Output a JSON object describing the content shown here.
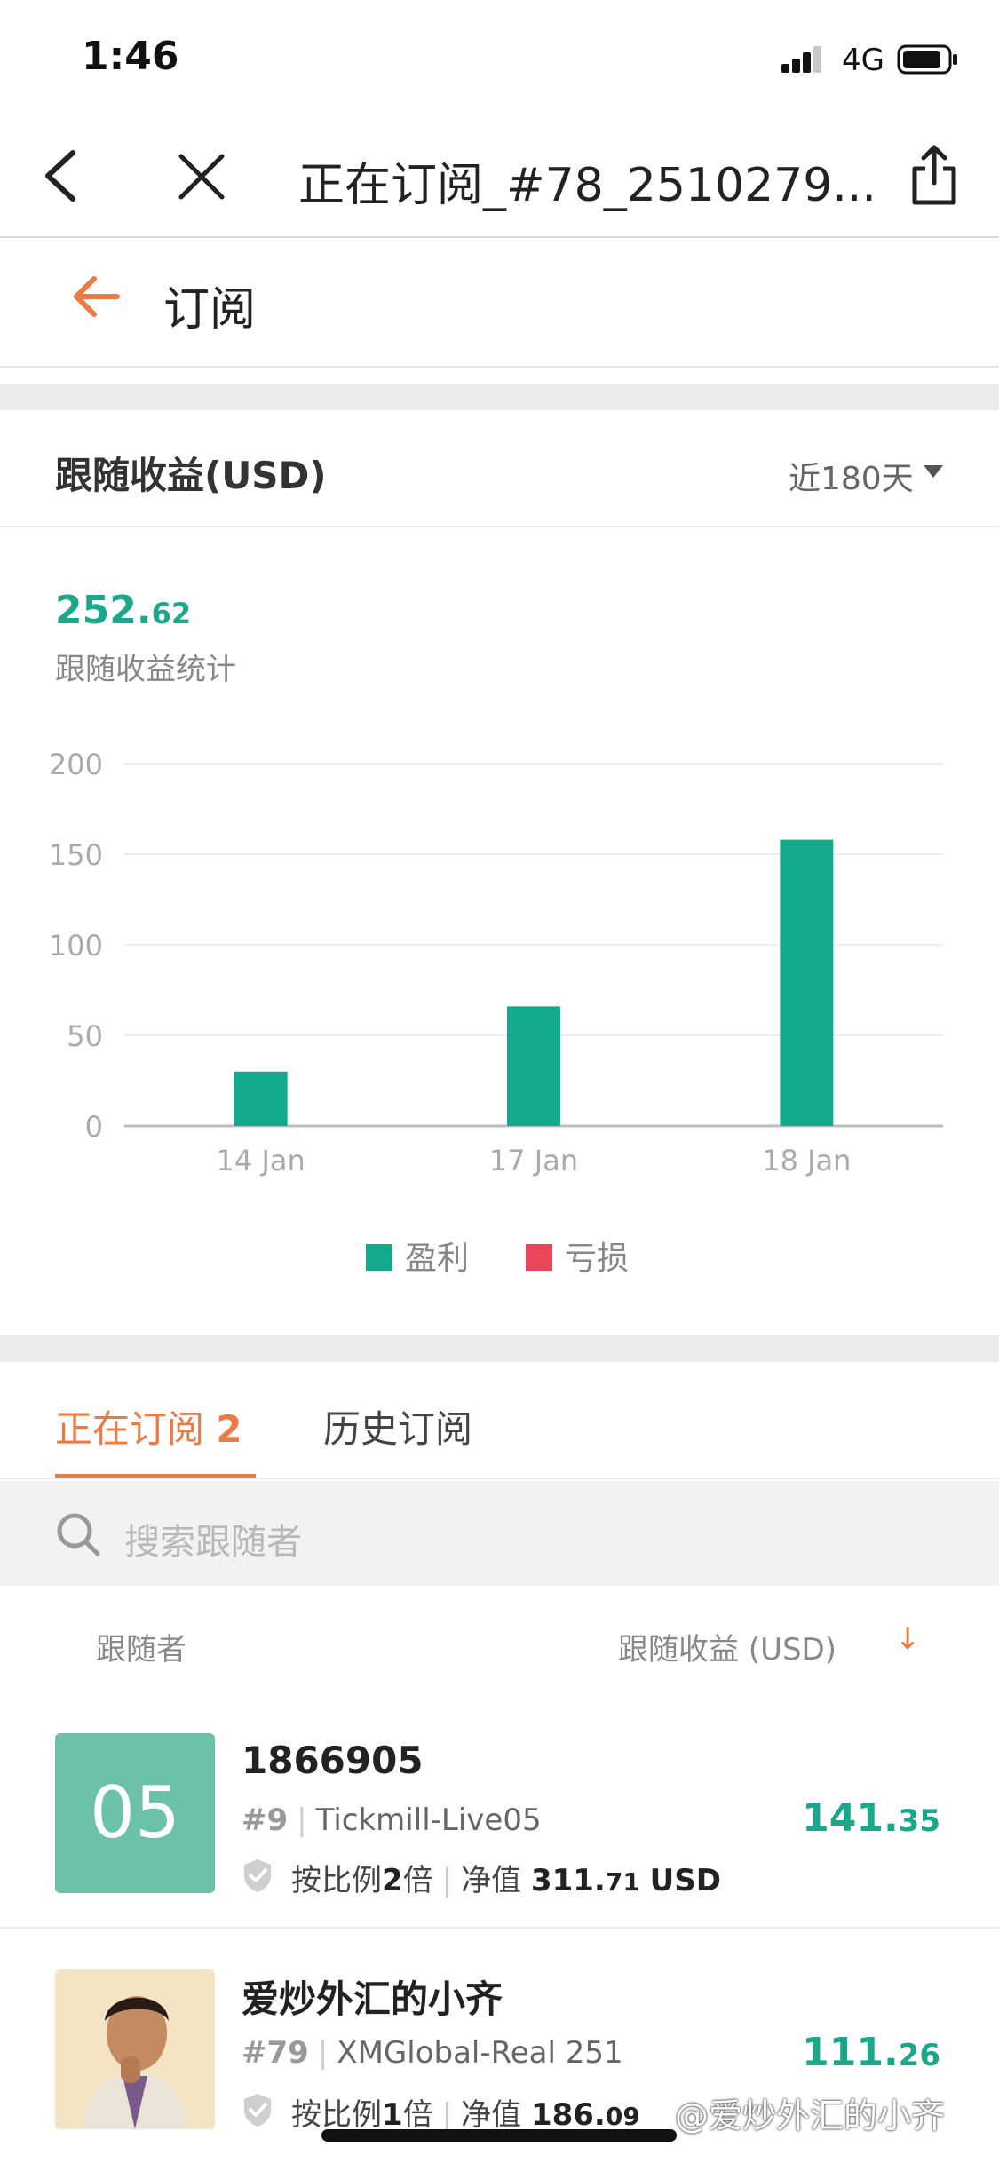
{
  "status_bar": {
    "time": "1:46",
    "network": "4G"
  },
  "browser_nav": {
    "title": "正在订阅_#78_2510279..."
  },
  "page_header": {
    "title": "订阅"
  },
  "profit_card": {
    "title": "跟随收益(USD)",
    "period": "近180天",
    "total_int": "252.",
    "total_dec": "62",
    "total_label": "跟随收益统计"
  },
  "chart_data": {
    "type": "bar",
    "categories": [
      "14 Jan",
      "17 Jan",
      "18 Jan"
    ],
    "series": [
      {
        "name": "盈利",
        "values": [
          30,
          66,
          158
        ],
        "color": "#13aa8b"
      },
      {
        "name": "亏损",
        "values": [
          0,
          0,
          0
        ],
        "color": "#e8475a"
      }
    ],
    "yticks": [
      0,
      50,
      100,
      150,
      200
    ],
    "ylim": [
      0,
      200
    ],
    "grid": true,
    "legend_position": "bottom-center"
  },
  "tabs": {
    "active_label": "正在订阅",
    "active_count": "2",
    "history_label": "历史订阅"
  },
  "search": {
    "placeholder": "搜索跟随者"
  },
  "list_header": {
    "follower": "跟随者",
    "profit": "跟随收益 (USD)"
  },
  "rows": [
    {
      "avatar_text": "05",
      "name": "1866905",
      "rank": "#9",
      "server": "Tickmill-Live05",
      "ratio_prefix": "按比例",
      "ratio_value": "2",
      "ratio_suffix": "倍",
      "equity_label": "净值",
      "equity_int": "311.",
      "equity_dec": "71",
      "equity_unit": "USD",
      "profit_int": "141.",
      "profit_dec": "35"
    },
    {
      "name": "爱炒外汇的小齐",
      "rank": "#79",
      "server": "XMGlobal-Real 251",
      "ratio_prefix": "按比例",
      "ratio_value": "1",
      "ratio_suffix": "倍",
      "equity_label": "净值",
      "equity_int": "186.",
      "equity_dec": "09",
      "profit_int": "111.",
      "profit_dec": "26"
    }
  ],
  "watermark": "@爱炒外汇的小齐",
  "colors": {
    "accent": "#ec7a45",
    "profit": "#1aa88b",
    "loss": "#e8475a"
  }
}
